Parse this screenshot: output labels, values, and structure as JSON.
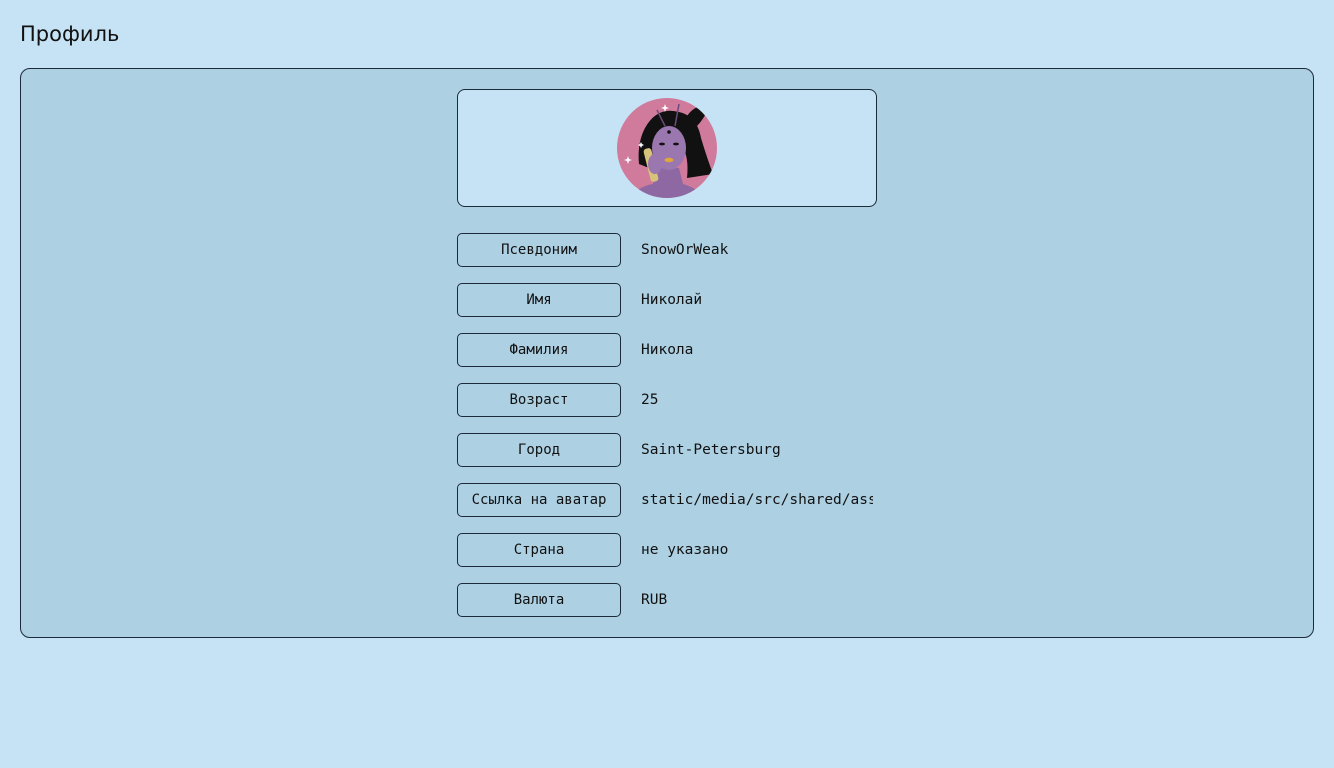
{
  "page": {
    "title": "Профиль"
  },
  "avatar": {
    "icon": "avatar-image",
    "bg_color": "#d07a9c"
  },
  "fields": [
    {
      "label": "Псевдоним",
      "value": "SnowOrWeak"
    },
    {
      "label": "Имя",
      "value": "Николай"
    },
    {
      "label": "Фамилия",
      "value": "Никола"
    },
    {
      "label": "Возраст",
      "value": "25"
    },
    {
      "label": "Город",
      "value": "Saint-Petersburg"
    },
    {
      "label": "Ссылка на аватар",
      "value": "static/media/src/shared/assets"
    },
    {
      "label": "Страна",
      "value": "не указано"
    },
    {
      "label": "Валюта",
      "value": "RUB"
    }
  ],
  "colors": {
    "page_bg": "#c5e3f4",
    "card_bg": "#add0e3",
    "border": "#1c2a3a"
  }
}
